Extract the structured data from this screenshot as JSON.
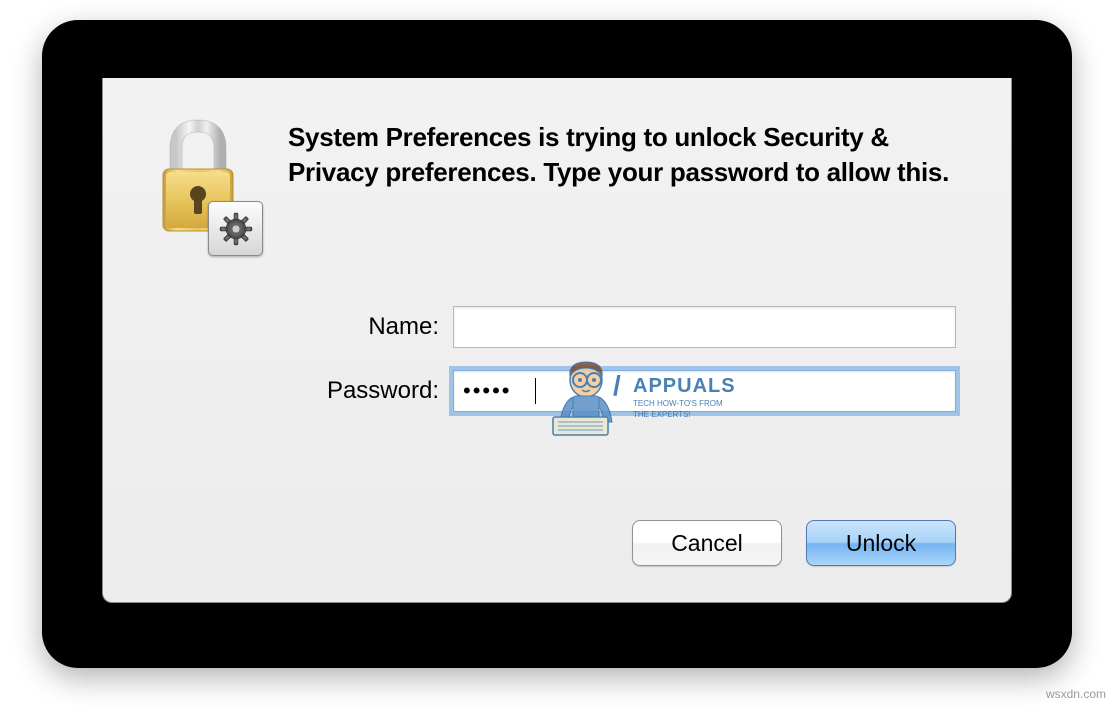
{
  "dialog": {
    "message": "System Preferences is trying to unlock Security & Privacy preferences. Type your password to allow this.",
    "name_label": "Name:",
    "password_label": "Password:",
    "name_value": "",
    "password_value": "•••••",
    "cancel_label": "Cancel",
    "unlock_label": "Unlock"
  },
  "icons": {
    "main": "lock-icon",
    "badge": "gear-icon"
  },
  "watermark": {
    "text": "wsxdn.com"
  },
  "overlay": {
    "brand": "APPUALS",
    "tagline_line1": "TECH HOW-TO'S FROM",
    "tagline_line2": "THE EXPERTS!"
  }
}
